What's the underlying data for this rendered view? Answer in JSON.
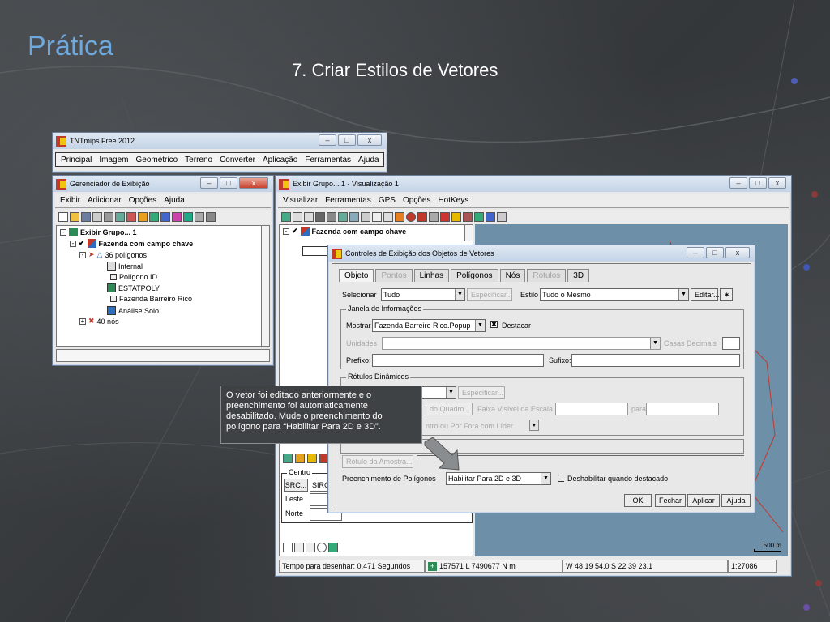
{
  "slide": {
    "title": "Prática",
    "subtitle": "7. Criar Estilos de Vetores"
  },
  "tntmips_window": {
    "title": "TNTmips Free 2012",
    "menu": [
      "Principal",
      "Imagem",
      "Geométrico",
      "Terreno",
      "Converter",
      "Aplicação",
      "Ferramentas",
      "Ajuda"
    ]
  },
  "display_manager": {
    "title": "Gerenciador de Exibição",
    "menu": [
      "Exibir",
      "Adicionar",
      "Opções",
      "Ajuda"
    ],
    "tree": {
      "group": "Exibir Grupo... 1",
      "layer": "Fazenda com campo chave",
      "polygons": "36 polígonos",
      "items": [
        "Internal",
        "Polígono ID",
        "ESTATPOLY",
        "Fazenda Barreiro Rico",
        "Análise Solo"
      ],
      "nodes": "40 nós"
    }
  },
  "view_window": {
    "title": "Exibir Grupo... 1 - Visualização 1",
    "menu": [
      "Visualizar",
      "Ferramentas",
      "GPS",
      "Opções",
      "HotKeys"
    ],
    "layer_label": "Fazenda com campo chave",
    "centro": {
      "label": "Centro",
      "src_label": "SRC...",
      "src_value": "SIRG",
      "leste": "Leste",
      "norte": "Norte"
    },
    "status": {
      "draw_time": "Tempo para desenhar: 0.471 Segundos",
      "coords": "157571 L  7490677 N m",
      "latlon": "W 48 19 54.0  S 22 39 23.1",
      "scale": "1:27086"
    },
    "scale_bar": "500 m"
  },
  "dialog": {
    "title": "Controles de Exibição dos Objetos de Vetores",
    "tabs": [
      {
        "label": "Objeto",
        "disabled": false,
        "active": true
      },
      {
        "label": "Pontos",
        "disabled": true,
        "active": false
      },
      {
        "label": "Linhas",
        "disabled": false,
        "active": false
      },
      {
        "label": "Polígonos",
        "disabled": false,
        "active": false
      },
      {
        "label": "Nós",
        "disabled": false,
        "active": false
      },
      {
        "label": "Rótulos",
        "disabled": true,
        "active": false
      },
      {
        "label": "3D",
        "disabled": false,
        "active": false
      }
    ],
    "select_label": "Selecionar",
    "select_value": "Tudo",
    "specify_button": "Especificar...",
    "style_label": "Estilo",
    "style_value": "Tudo o Mesmo",
    "edit_button": "Editar...",
    "info_group": "Janela de Informações",
    "show_label": "Mostrar",
    "show_value": "Fazenda Barreiro Rico.Popup",
    "highlight_label": "Destacar",
    "units_label": "Unidades",
    "decimal_label": "Casas Decimais",
    "prefix_label": "Prefixo:",
    "suffix_label": "Sufixo:",
    "dynamic_group": "Rótulos Dinâmicos",
    "specify2_button": "Especificar...",
    "frame_button": "do Quadro...",
    "visible_range_label": "Faixa Visível da Escala",
    "to_label": "para",
    "center_option": "ntro ou Por Fora com Líder",
    "sample_label_button": "Rótulo da Amostra...",
    "fill_label": "Preenchimento de Polígonos",
    "fill_value": "Habilitar Para 2D e 3D",
    "disable_highlight_label": "Deshabilitar quando destacado",
    "ok_button": "OK",
    "close_button": "Fechar",
    "apply_button": "Aplicar",
    "help_button": "Ajuda"
  },
  "callout_text": "O vetor foi editado anteriormente e o preenchimento foi automaticamente desabilitado. Mude o preenchimento do polígono para “Habilitar Para 2D e 3D”.",
  "colors": {
    "title_blue": "#6fa8dc",
    "map_blue": "#6e8fa8",
    "background": "#3b3d3f"
  }
}
